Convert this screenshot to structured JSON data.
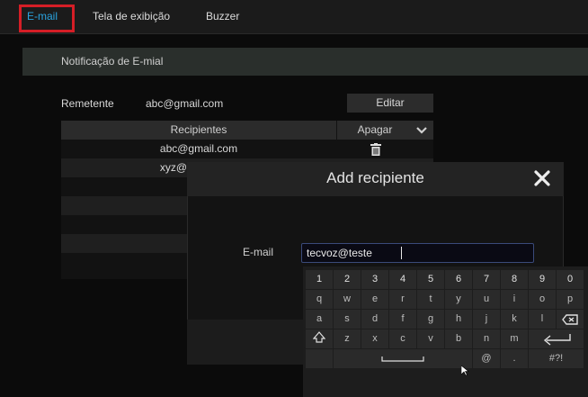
{
  "tabs": [
    {
      "label": "E-mail",
      "active": true
    },
    {
      "label": "Tela de exibição",
      "active": false
    },
    {
      "label": "Buzzer",
      "active": false
    }
  ],
  "section": {
    "title": "Notificação de E-mial"
  },
  "sender": {
    "label": "Remetente",
    "value": "abc@gmail.com",
    "edit_label": "Editar"
  },
  "recipients_table": {
    "col_recipients": "Recipientes",
    "col_delete": "Apagar",
    "rows": [
      "abc@gmail.com",
      "xyz@"
    ]
  },
  "dialog": {
    "title": "Add recipiente",
    "email_label": "E-mail",
    "email_value": "tecvoz@teste"
  },
  "keyboard": {
    "row1": [
      "1",
      "2",
      "3",
      "4",
      "5",
      "6",
      "7",
      "8",
      "9",
      "0"
    ],
    "row2": [
      "q",
      "w",
      "e",
      "r",
      "t",
      "y",
      "u",
      "i",
      "o",
      "p"
    ],
    "row3": [
      "a",
      "s",
      "d",
      "f",
      "g",
      "h",
      "j",
      "k",
      "l"
    ],
    "row4": [
      "z",
      "x",
      "c",
      "v",
      "b",
      "n",
      "m"
    ],
    "at": "@",
    "dot": ".",
    "symbols": "#?!"
  },
  "colors": {
    "accent": "#2aa4e0",
    "highlight": "#d51e26"
  }
}
